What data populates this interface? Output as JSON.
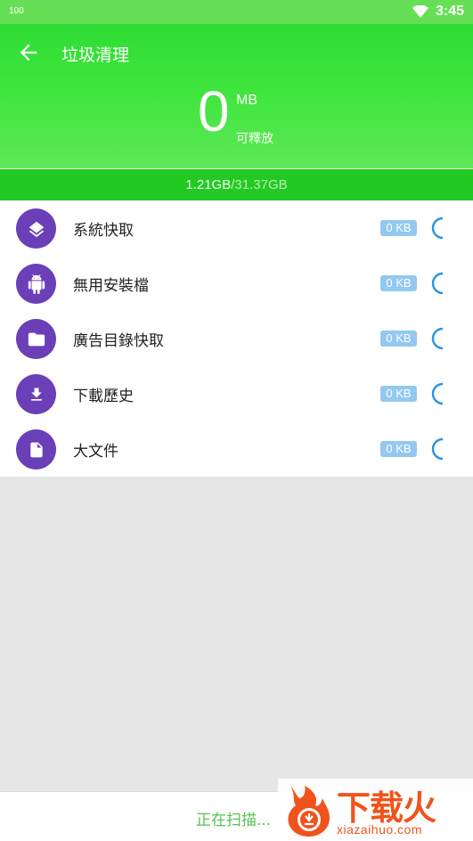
{
  "status_bar": {
    "left_text": "100",
    "time": "3:45"
  },
  "header": {
    "title": "垃圾清理",
    "freed_value": "0",
    "freed_unit": "MB",
    "freed_label": "可釋放"
  },
  "storage": {
    "used": "1.21GB",
    "separator": "/",
    "total": "31.37GB"
  },
  "items": [
    {
      "label": "系統快取",
      "size": "0 KB",
      "icon": "layers-icon"
    },
    {
      "label": "無用安裝檔",
      "size": "0 KB",
      "icon": "android-icon"
    },
    {
      "label": "廣告目錄快取",
      "size": "0 KB",
      "icon": "folder-icon"
    },
    {
      "label": "下載歷史",
      "size": "0 KB",
      "icon": "download-icon"
    },
    {
      "label": "大文件",
      "size": "0 KB",
      "icon": "file-icon"
    }
  ],
  "footer": {
    "scan_status": "正在扫描..."
  },
  "watermark": {
    "text": "下载火",
    "url": "xiazaihuo.com"
  },
  "colors": {
    "accent": "#3ee53c",
    "icon_bg": "#6a3fb8",
    "badge": "#93c8f0",
    "spinner": "#2a93e0"
  }
}
